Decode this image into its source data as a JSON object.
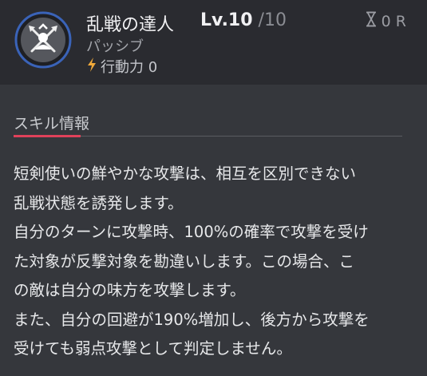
{
  "skill": {
    "name": "乱戦の達人",
    "level_label": "Lv.10",
    "level_max": "/10",
    "type": "パッシブ",
    "action_power": "行動力 0",
    "cooldown": "0 R",
    "icon": "crossed-swords-person-icon"
  },
  "info": {
    "section_title": "スキル情報",
    "description_lines": [
      "短剣使いの鮮やかな攻撃は、相互を区別できない",
      "乱戦状態を誘発します。",
      "自分のターンに攻撃時、100%の確率で攻撃を受け",
      "た対象が反撃対象を勘違いします。この場合、こ",
      "の敵は自分の味方を攻撃します。",
      "また、自分の回避が190%増加し、後方から攻撃を",
      "受けても弱点攻撃として判定しません。"
    ]
  },
  "colors": {
    "accent": "#e0415a",
    "icon_ring": "#3a63b8",
    "background": "#35373c",
    "header_background": "#2a2b30"
  }
}
